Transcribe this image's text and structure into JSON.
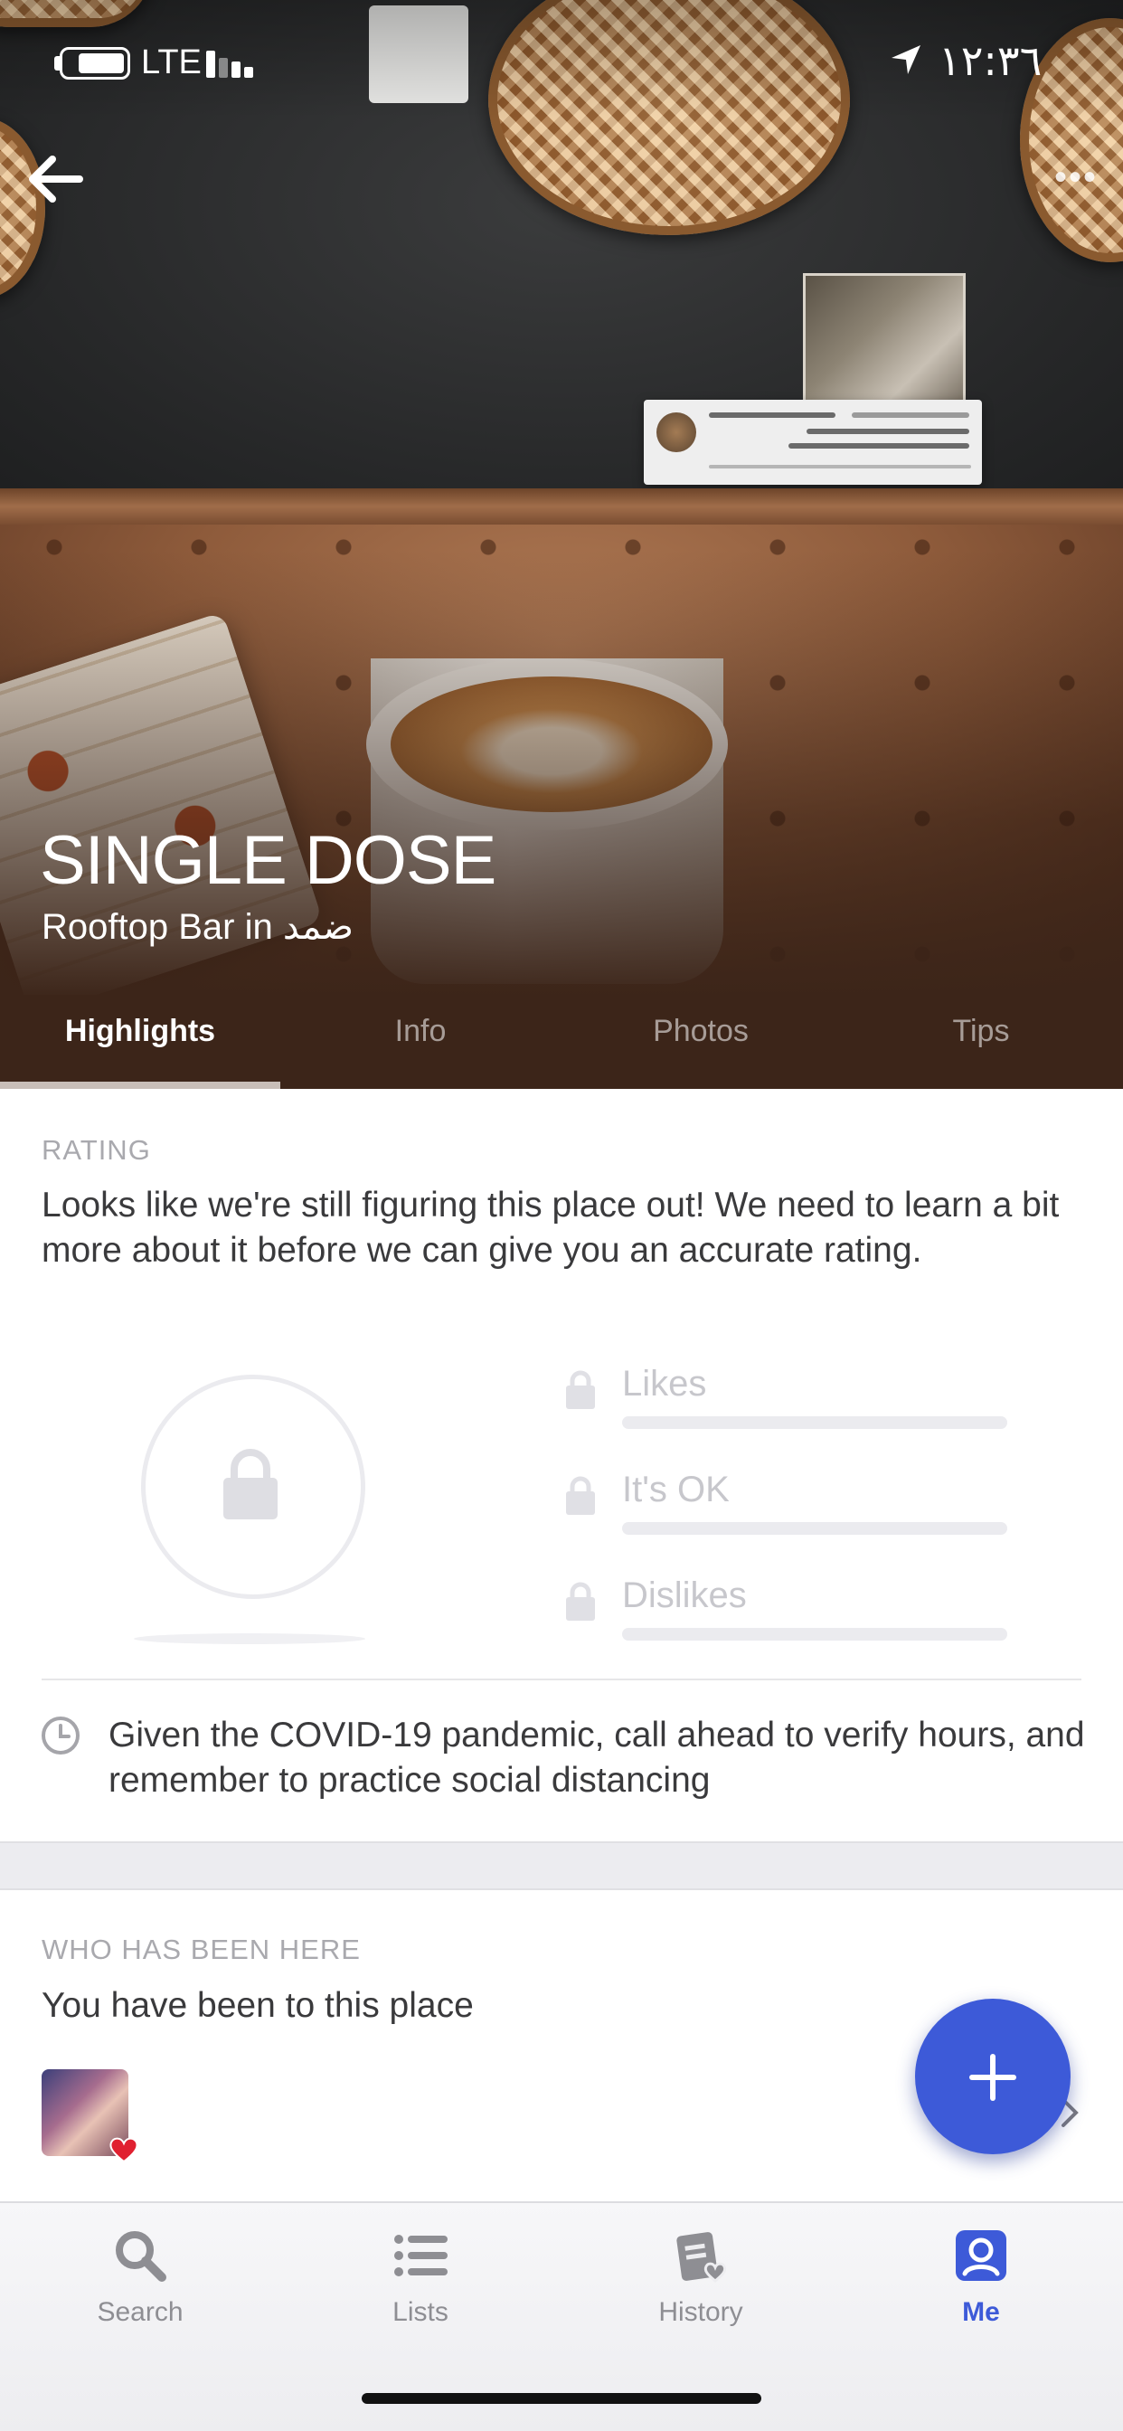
{
  "status_bar": {
    "network": "LTE",
    "time": "١٢:٣٦"
  },
  "header": {
    "title": "SINGLE DOSE",
    "subtitle": "Rooftop Bar in ضمد"
  },
  "tabs": [
    {
      "label": "Highlights",
      "active": true
    },
    {
      "label": "Info",
      "active": false
    },
    {
      "label": "Photos",
      "active": false
    },
    {
      "label": "Tips",
      "active": false
    }
  ],
  "rating": {
    "section_label": "RATING",
    "message": "Looks like we're still figuring this place out! We need to learn a bit more about it before we can give you an accurate rating.",
    "rows": [
      {
        "label": "Likes",
        "fill": 0
      },
      {
        "label": "It's OK",
        "fill": 0
      },
      {
        "label": "Dislikes",
        "fill": 0
      }
    ]
  },
  "covid_notice": "Given the COVID-19 pandemic, call ahead to verify hours, and remember to practice social distancing",
  "visitors": {
    "section_label": "WHO HAS BEEN HERE",
    "message": "You have been to this place"
  },
  "tabbar": [
    {
      "label": "Search",
      "icon": "search-icon",
      "active": false
    },
    {
      "label": "Lists",
      "icon": "list-icon",
      "active": false
    },
    {
      "label": "History",
      "icon": "history-icon",
      "active": false
    },
    {
      "label": "Me",
      "icon": "profile-icon",
      "active": true
    }
  ],
  "colors": {
    "accent": "#3d5ad8",
    "tab_bg": "#3c2519",
    "muted": "#c7c7cc"
  }
}
